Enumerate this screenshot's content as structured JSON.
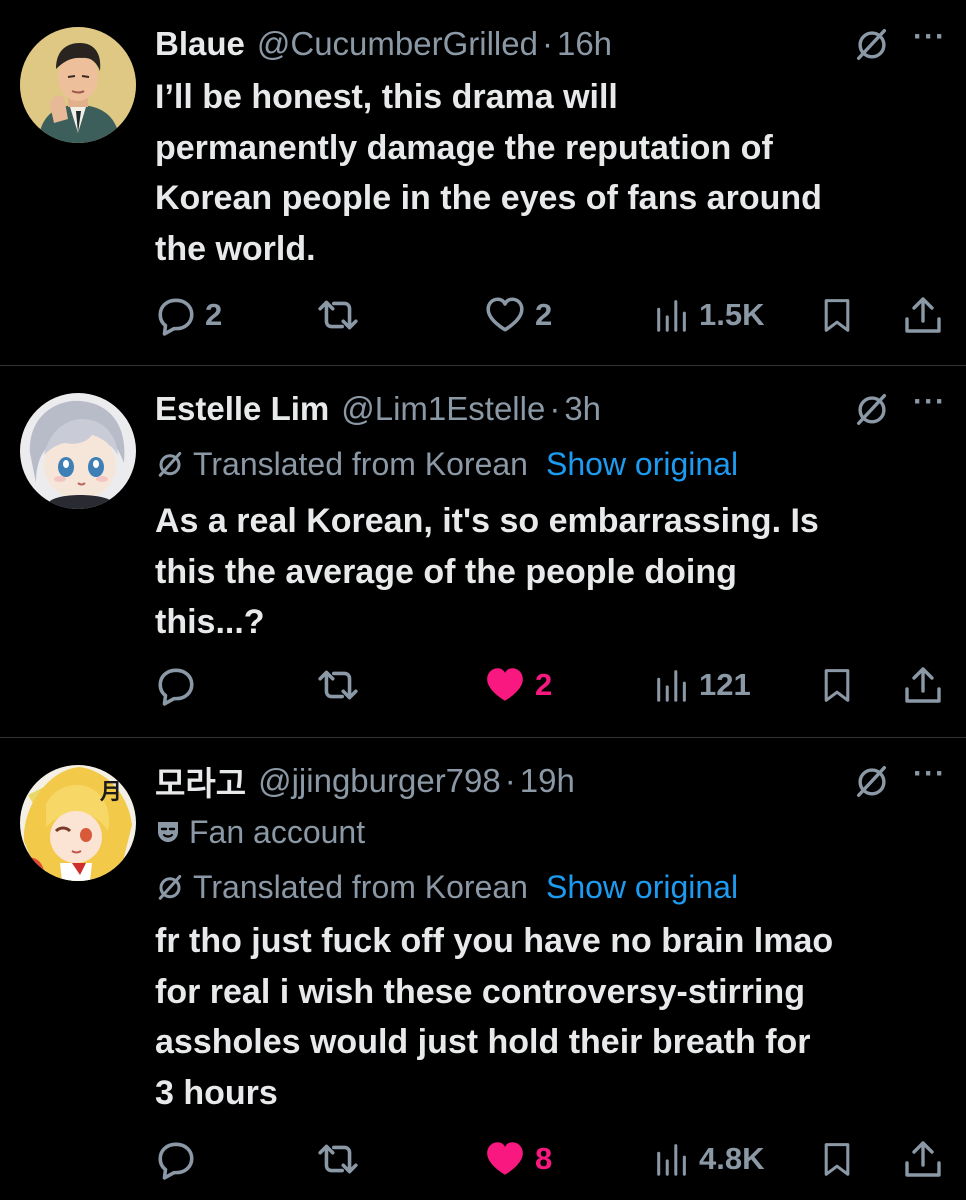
{
  "tweets": [
    {
      "name": "Blaue",
      "handle": "@CucumberGrilled",
      "dot": "·",
      "time": "16h",
      "text": "I’ll be honest, this drama will\npermanently damage the reputation of\nKorean people in the eyes of fans around\nthe world.",
      "replies": "2",
      "reposts": "",
      "likes": "2",
      "liked": false,
      "views": "1.5K"
    },
    {
      "name": "Estelle Lim",
      "handle": "@Lim1Estelle",
      "dot": "·",
      "time": "3h",
      "translated_label": "Translated from Korean",
      "show_original": "Show original",
      "text": "As a real Korean, it's so embarrassing. Is\nthis the average of the people doing\nthis...?",
      "replies": "",
      "reposts": "",
      "likes": "2",
      "liked": true,
      "views": "121"
    },
    {
      "name": "모라고",
      "handle": "@jjingburger798",
      "dot": "·",
      "time": "19h",
      "fan_label": "Fan account",
      "translated_label": "Translated from Korean",
      "show_original": "Show original",
      "text": "fr tho just fuck off you have no brain lmao\nfor real i wish these controversy-stirring\nassholes would just hold their breath for\n3 hours",
      "replies": "",
      "reposts": "",
      "likes": "8",
      "liked": true,
      "views": "4.8K"
    }
  ],
  "more_label": "···",
  "colors": {
    "background": "#000000",
    "text": "#e7e9ea",
    "muted": "#8b98a5",
    "link": "#1d9bf0",
    "like": "#f91880"
  },
  "icons": [
    "grok-icon",
    "more-icon",
    "reply-icon",
    "repost-icon",
    "like-icon",
    "views-icon",
    "bookmark-icon",
    "share-icon",
    "translate-icon",
    "fan-mask-icon"
  ]
}
